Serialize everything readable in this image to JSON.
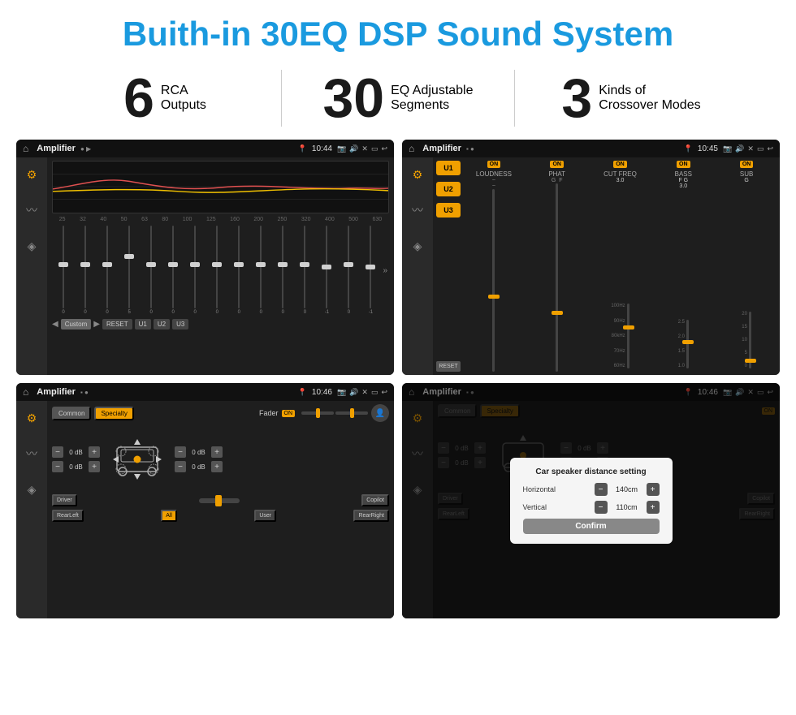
{
  "header": {
    "title": "Buith-in 30EQ DSP Sound System"
  },
  "stats": [
    {
      "number": "6",
      "label_line1": "RCA",
      "label_line2": "Outputs"
    },
    {
      "number": "30",
      "label_line1": "EQ Adjustable",
      "label_line2": "Segments"
    },
    {
      "number": "3",
      "label_line1": "Kinds of",
      "label_line2": "Crossover Modes"
    }
  ],
  "screens": [
    {
      "id": "eq-screen",
      "status_bar": {
        "app": "Amplifier",
        "time": "10:44"
      },
      "type": "equalizer"
    },
    {
      "id": "crossover-screen",
      "status_bar": {
        "app": "Amplifier",
        "time": "10:45"
      },
      "type": "crossover"
    },
    {
      "id": "fader-screen",
      "status_bar": {
        "app": "Amplifier",
        "time": "10:46"
      },
      "type": "fader"
    },
    {
      "id": "dialog-screen",
      "status_bar": {
        "app": "Amplifier",
        "time": "10:46"
      },
      "type": "dialog",
      "dialog": {
        "title": "Car speaker distance setting",
        "horizontal_label": "Horizontal",
        "horizontal_value": "140cm",
        "vertical_label": "Vertical",
        "vertical_value": "110cm",
        "confirm_label": "Confirm"
      }
    }
  ],
  "eq": {
    "frequencies": [
      "25",
      "32",
      "40",
      "50",
      "63",
      "80",
      "100",
      "125",
      "160",
      "200",
      "250",
      "320",
      "400",
      "500",
      "630"
    ],
    "values": [
      "0",
      "0",
      "0",
      "5",
      "0",
      "0",
      "0",
      "0",
      "0",
      "0",
      "0",
      "0",
      "-1",
      "0",
      "-1"
    ],
    "buttons": [
      "Custom",
      "RESET",
      "U1",
      "U2",
      "U3"
    ]
  },
  "crossover": {
    "channels": [
      "U1",
      "U2",
      "U3"
    ],
    "controls": [
      {
        "label": "LOUDNESS",
        "on": true,
        "value": ""
      },
      {
        "label": "PHAT",
        "on": true,
        "value": ""
      },
      {
        "label": "CUT FREQ",
        "on": true,
        "value": "3.0"
      },
      {
        "label": "BASS",
        "on": true,
        "value": "3.0"
      },
      {
        "label": "SUB",
        "on": true,
        "value": ""
      }
    ]
  },
  "fader": {
    "tabs": [
      "Common",
      "Specialty"
    ],
    "active_tab": "Specialty",
    "fader_label": "Fader",
    "fader_on": "ON",
    "volumes": [
      {
        "value": "0 dB"
      },
      {
        "value": "0 dB"
      },
      {
        "value": "0 dB"
      },
      {
        "value": "0 dB"
      }
    ],
    "bottom_buttons": [
      "Driver",
      "All",
      "User",
      "RearRight"
    ],
    "rear_left": "RearLeft",
    "all": "All"
  }
}
